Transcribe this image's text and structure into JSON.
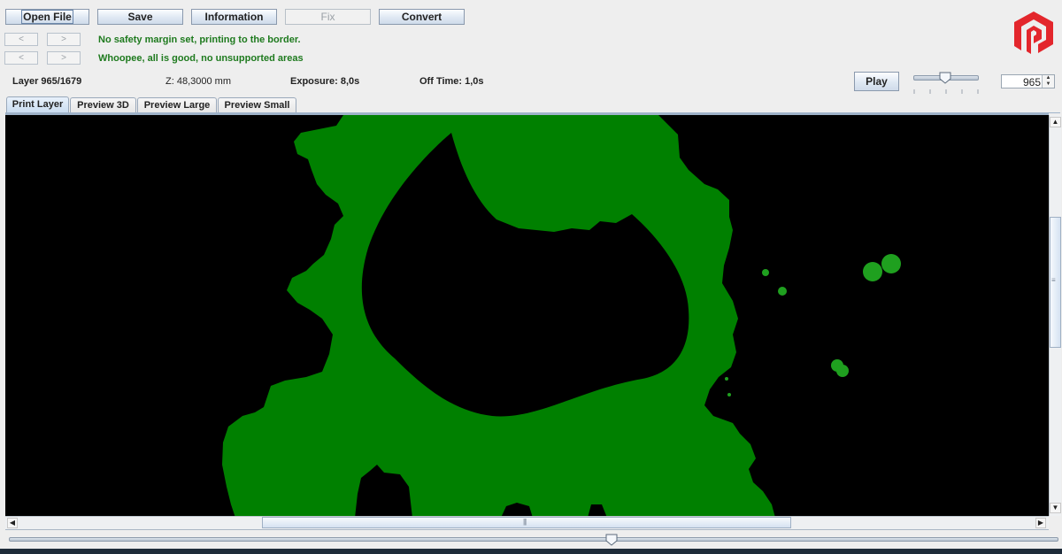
{
  "toolbar": {
    "open_file": "Open File",
    "save": "Save",
    "information": "Information",
    "fix": "Fix",
    "convert": "Convert"
  },
  "nav": {
    "prev": "<",
    "next": ">"
  },
  "messages": {
    "margin": "No safety margin set, printing to the border.",
    "support": "Whoopee, all is good, no unsupported areas"
  },
  "layer_info": {
    "layer": "Layer 965/1679",
    "z": "Z: 48,3000 mm",
    "exposure": "Exposure: 8,0s",
    "off_time": "Off Time: 1,0s"
  },
  "playback": {
    "play_label": "Play",
    "speed_slider_fraction": 0.5,
    "layer_value": "965"
  },
  "tabs": [
    {
      "label": "Print Layer",
      "active": true
    },
    {
      "label": "Preview 3D",
      "active": false
    },
    {
      "label": "Preview Large",
      "active": false
    },
    {
      "label": "Preview Small",
      "active": false
    }
  ],
  "layer_slider": {
    "current": 965,
    "total": 1679
  },
  "colors": {
    "layer_fill": "#008000",
    "background": "#000000",
    "message_text": "#1e7a1e",
    "logo": "#e3262c"
  },
  "icons": {
    "logo": "photon-logo-icon",
    "scroll_up": "arrow-up-icon",
    "scroll_down": "arrow-down-icon",
    "scroll_left": "arrow-left-icon",
    "scroll_right": "arrow-right-icon"
  }
}
